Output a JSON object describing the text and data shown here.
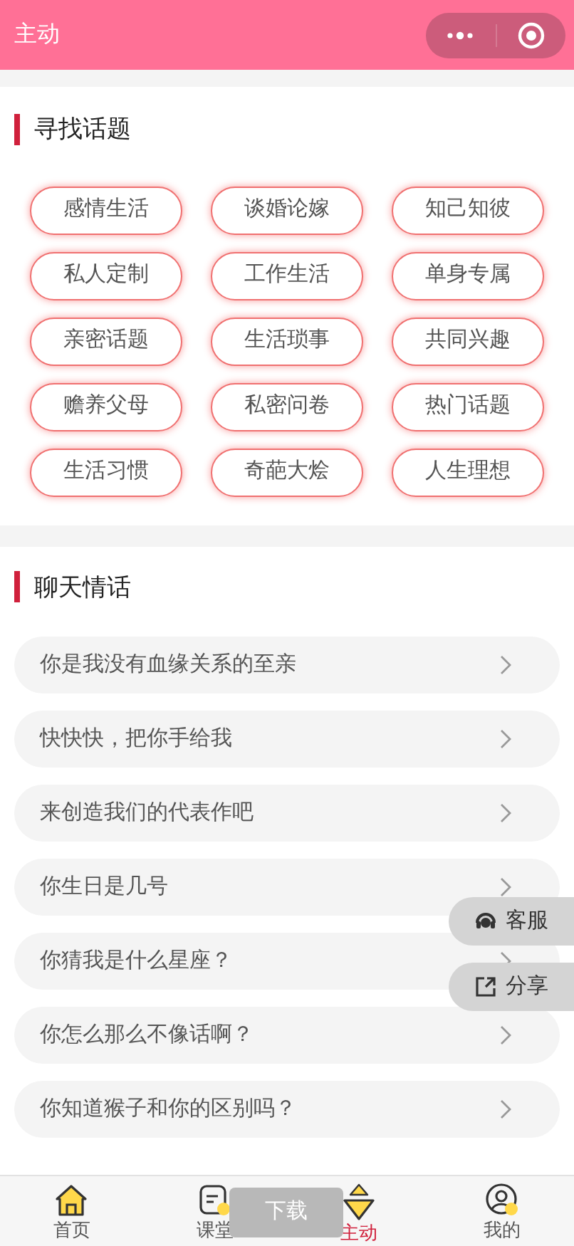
{
  "header": {
    "title": "主动"
  },
  "topics": {
    "title": "寻找话题",
    "tags": [
      "感情生活",
      "谈婚论嫁",
      "知己知彼",
      "私人定制",
      "工作生活",
      "单身专属",
      "亲密话题",
      "生活琐事",
      "共同兴趣",
      "赡养父母",
      "私密问卷",
      "热门话题",
      "生活习惯",
      "奇葩大烩",
      "人生理想"
    ]
  },
  "chats": {
    "title": "聊天情话",
    "items": [
      "你是我没有血缘关系的至亲",
      "快快快，把你手给我",
      "来创造我们的代表作吧",
      "你生日是几号",
      "你猜我是什么星座？",
      "你怎么那么不像话啊？",
      "你知道猴子和你的区别吗？"
    ]
  },
  "float_buttons": [
    {
      "kind": "service",
      "label": "客服"
    },
    {
      "kind": "share",
      "label": "分享"
    }
  ],
  "toast": "下载",
  "tab_bar": [
    {
      "kind": "home",
      "label": "首页",
      "selected": false
    },
    {
      "kind": "class",
      "label": "课堂",
      "selected": false
    },
    {
      "kind": "active",
      "label": "主动",
      "selected": true
    },
    {
      "kind": "mine",
      "label": "我的",
      "selected": false
    }
  ]
}
